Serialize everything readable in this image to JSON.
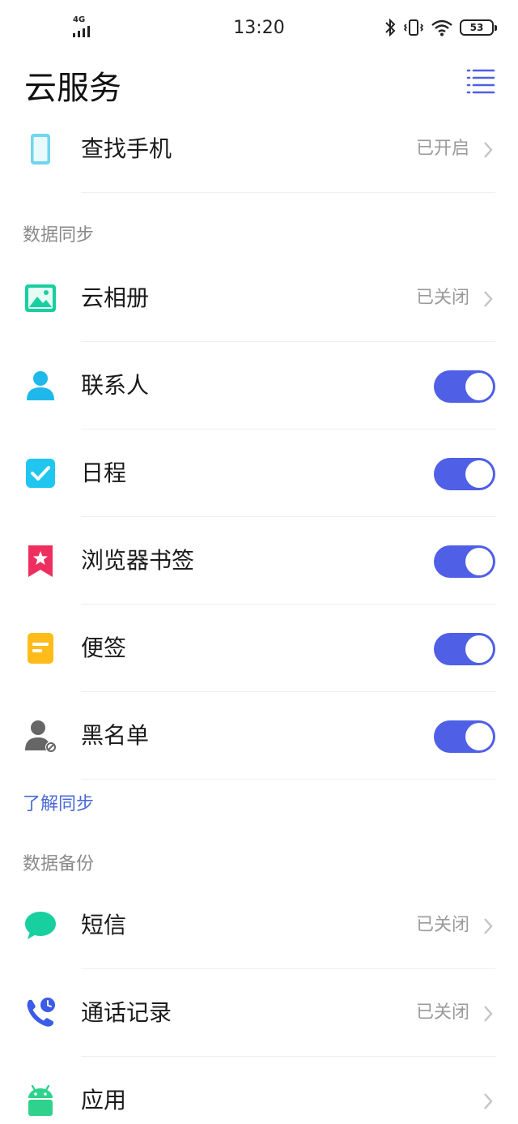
{
  "status_bar": {
    "network": "4G",
    "time": "13:20",
    "battery": "53"
  },
  "header": {
    "title": "云服务"
  },
  "find_phone": {
    "label": "查找手机",
    "status": "已开启"
  },
  "data_sync": {
    "section_title": "数据同步",
    "items": [
      {
        "label": "云相册",
        "status": "已关闭",
        "type": "link"
      },
      {
        "label": "联系人",
        "type": "toggle",
        "on": true
      },
      {
        "label": "日程",
        "type": "toggle",
        "on": true
      },
      {
        "label": "浏览器书签",
        "type": "toggle",
        "on": true
      },
      {
        "label": "便签",
        "type": "toggle",
        "on": true
      },
      {
        "label": "黑名单",
        "type": "toggle",
        "on": true
      }
    ],
    "learn_link": "了解同步"
  },
  "data_backup": {
    "section_title": "数据备份",
    "items": [
      {
        "label": "短信",
        "status": "已关闭"
      },
      {
        "label": "通话记录",
        "status": "已关闭"
      },
      {
        "label": "应用",
        "status": ""
      }
    ]
  },
  "colors": {
    "accent": "#4f5fe6",
    "link": "#4a6ad8",
    "status_text": "#9a9a9a",
    "section_text": "#8a8a8a"
  },
  "icons": [
    "phone-icon",
    "photo-icon",
    "contact-icon",
    "checkbox-icon",
    "bookmark-icon",
    "note-icon",
    "blocked-user-icon",
    "message-icon",
    "call-log-icon",
    "android-icon"
  ]
}
